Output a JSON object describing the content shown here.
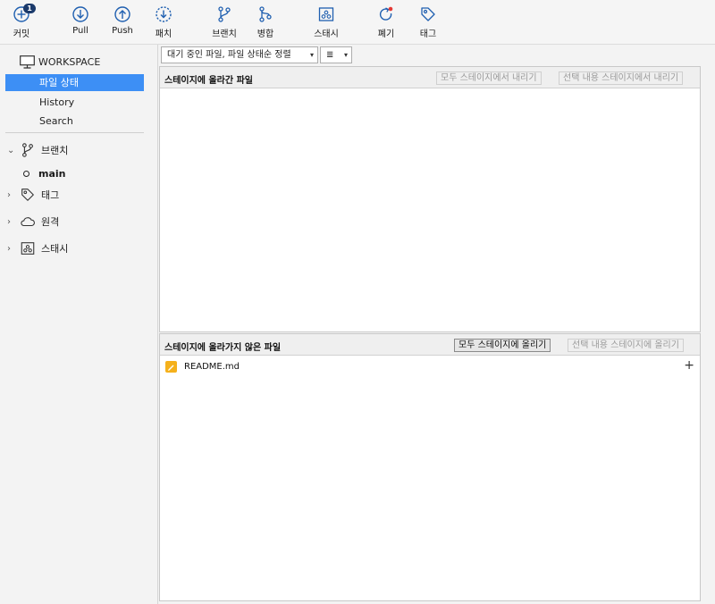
{
  "toolbar": {
    "commit": {
      "label": "커밋",
      "badge": "1"
    },
    "pull": {
      "label": "Pull"
    },
    "push": {
      "label": "Push"
    },
    "patch": {
      "label": "패치"
    },
    "branch": {
      "label": "브랜치"
    },
    "merge": {
      "label": "병합"
    },
    "stash": {
      "label": "스태시"
    },
    "discard": {
      "label": "폐기"
    },
    "tag": {
      "label": "태그"
    }
  },
  "sidebar": {
    "workspace": "WORKSPACE",
    "items": [
      {
        "label": "파일 상태",
        "selected": true
      },
      {
        "label": "History",
        "selected": false
      },
      {
        "label": "Search",
        "selected": false
      }
    ],
    "groups": {
      "branches": "브랜치",
      "branch_current": "main",
      "tags": "태그",
      "remotes": "원격",
      "stashes": "스태시"
    }
  },
  "filter": {
    "mode": "대기 중인 파일, 파일 상태순 정렬",
    "view_icon": "list-icon"
  },
  "staged": {
    "title": "스테이지에 올라간 파일",
    "unstage_all": "모두 스테이지에서 내리기",
    "unstage_selected": "선택 내용 스테이지에서 내리기"
  },
  "unstaged": {
    "title": "스테이지에 올라가지 않은 파일",
    "stage_all": "모두 스테이지에 올리기",
    "stage_selected": "선택 내용 스테이지에 올리기",
    "files": [
      {
        "name": "README.md",
        "status": "modified"
      }
    ]
  },
  "colors": {
    "accent": "#3d8ff5",
    "icon_blue": "#1f5fb0",
    "modified": "#f5b11c",
    "discard_dot": "#e53935"
  }
}
